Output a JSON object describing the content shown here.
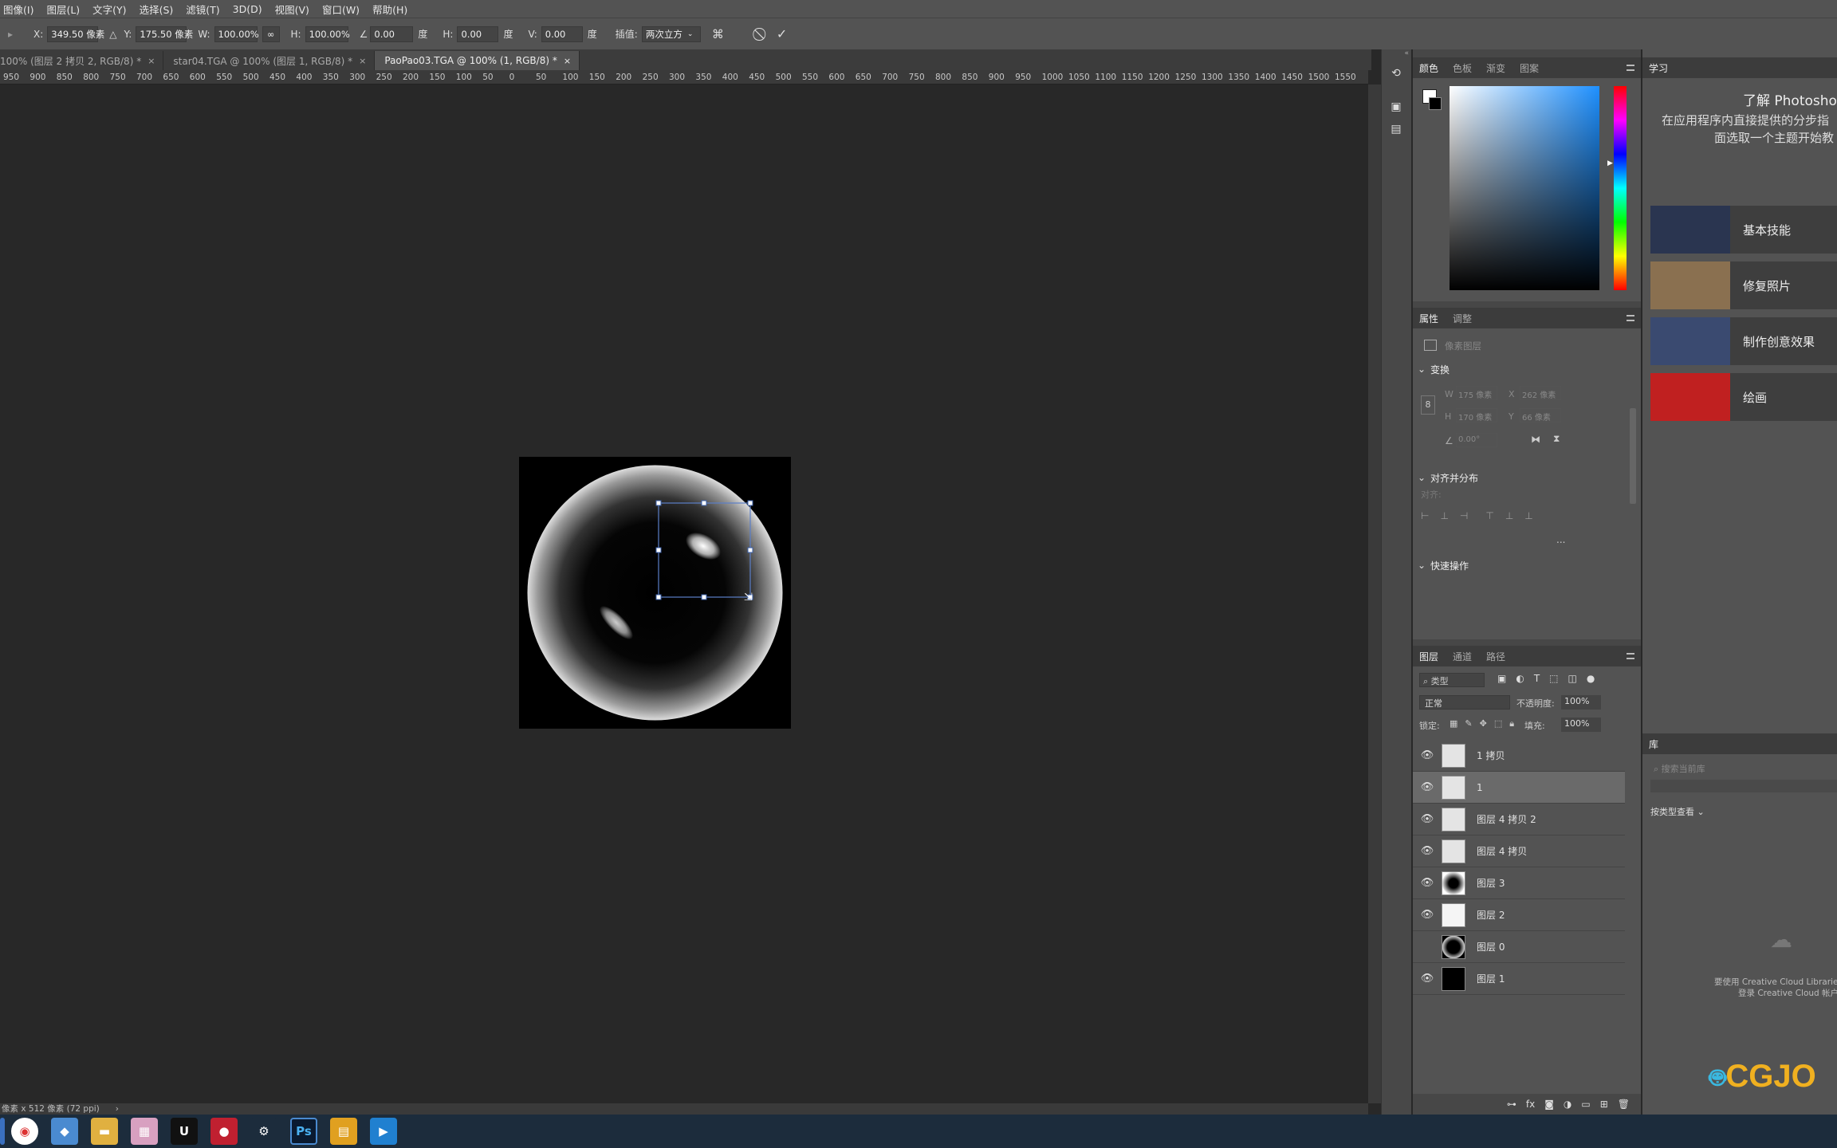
{
  "menu": [
    "图像(I)",
    "图层(L)",
    "文字(Y)",
    "选择(S)",
    "滤镜(T)",
    "3D(D)",
    "视图(V)",
    "窗口(W)",
    "帮助(H)"
  ],
  "options": {
    "x_label": "X:",
    "x_value": "349.50 像素",
    "y_label": "Y:",
    "y_value": "175.50 像素",
    "w_label": "W:",
    "w_value": "100.00%",
    "h_label": "H:",
    "h_value": "100.00%",
    "angle_value": "0.00",
    "angle_unit": "度",
    "hskew_label": "H:",
    "hskew_value": "0.00",
    "hskew_unit": "度",
    "vskew_label": "V:",
    "vskew_value": "0.00",
    "vskew_unit": "度",
    "interp_label": "插值:",
    "interp_value": "两次立方"
  },
  "tabs": [
    {
      "label": "100% (图层 2 拷贝 2, RGB/8) *"
    },
    {
      "label": "star04.TGA @ 100% (图层 1, RGB/8) *"
    },
    {
      "label": "PaoPao03.TGA @ 100% (1, RGB/8) *"
    }
  ],
  "ruler": [
    "950",
    "900",
    "850",
    "800",
    "750",
    "700",
    "650",
    "600",
    "550",
    "500",
    "450",
    "400",
    "350",
    "300",
    "250",
    "200",
    "150",
    "100",
    "50",
    "0",
    "50",
    "100",
    "150",
    "200",
    "250",
    "300",
    "350",
    "400",
    "450",
    "500",
    "550",
    "600",
    "650",
    "700",
    "750",
    "800",
    "850",
    "900",
    "950",
    "1000",
    "1050",
    "1100",
    "1150",
    "1200",
    "1250",
    "1300",
    "1350",
    "1400",
    "1450",
    "1500",
    "1550"
  ],
  "status": "像素 x 512 像素 (72 ppi)",
  "color_panel": {
    "tabs": [
      "颜色",
      "色板",
      "渐变",
      "图案"
    ]
  },
  "props_panel": {
    "tabs": [
      "属性",
      "调整"
    ],
    "layer_type": "像素图层",
    "transform": "变换",
    "w": "175 像素",
    "x": "262 像素",
    "h": "170 像素",
    "y": "66 像素",
    "angle": "0.00°",
    "align": "对齐并分布",
    "align_sub": "对齐:",
    "quick": "快速操作",
    "more": "..."
  },
  "layers_panel": {
    "tabs": [
      "图层",
      "通道",
      "路径"
    ],
    "filter": "类型",
    "blend": "正常",
    "opacity_label": "不透明度:",
    "opacity": "100%",
    "lock_label": "锁定:",
    "fill_label": "填充:",
    "fill": "100%",
    "layers": [
      {
        "name": "1 拷贝",
        "visible": true,
        "selected": false,
        "thumb": "#e4e4e4"
      },
      {
        "name": "1",
        "visible": true,
        "selected": true,
        "thumb": "#e4e4e4"
      },
      {
        "name": "图层 4 拷贝 2",
        "visible": true,
        "selected": false,
        "thumb": "#e4e4e4"
      },
      {
        "name": "图层 4 拷贝",
        "visible": true,
        "selected": false,
        "thumb": "#e4e4e4"
      },
      {
        "name": "图层 3",
        "visible": true,
        "selected": false,
        "thumb": "radial"
      },
      {
        "name": "图层 2",
        "visible": true,
        "selected": false,
        "thumb": "#f5f5f5"
      },
      {
        "name": "图层 0",
        "visible": false,
        "selected": false,
        "thumb": "bubble"
      },
      {
        "name": "图层 1",
        "visible": true,
        "selected": false,
        "thumb": "#000000"
      }
    ]
  },
  "learn_panel": {
    "tab": "学习",
    "title": "了解 Photoshop",
    "desc1": "在应用程序内直接提供的分步指",
    "desc2": "面选取一个主题开始教",
    "items": [
      {
        "label": "基本技能",
        "color": "#2a3550"
      },
      {
        "label": "修复照片",
        "color": "#8a7050"
      },
      {
        "label": "制作创意效果",
        "color": "#3a4a70"
      },
      {
        "label": "绘画",
        "color": "#c02020"
      }
    ]
  },
  "library_panel": {
    "tab": "库",
    "search": "搜索当前库",
    "view": "按类型查看",
    "msg1": "要使用 Creative Cloud Libraries,",
    "msg2": "登录 Creative Cloud 帐户。"
  },
  "watermark": "CGJO",
  "taskbar": [
    "chrome-icon",
    "app-icon",
    "folder-icon",
    "image-icon",
    "unreal-icon",
    "record-icon",
    "settings-icon",
    "Ps",
    "files-icon",
    "video-icon"
  ]
}
